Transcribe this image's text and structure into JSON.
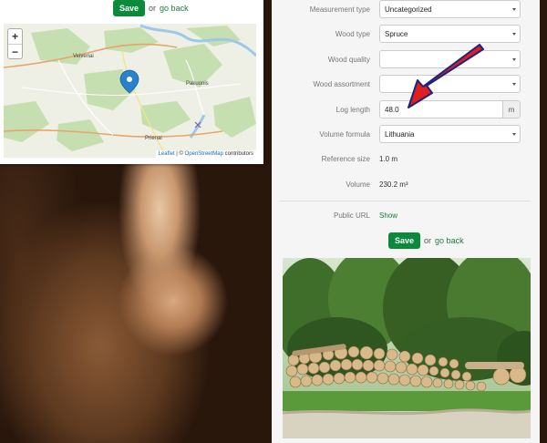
{
  "top_bar": {
    "save_label": "Save",
    "or_text": "or",
    "go_back_label": "go back"
  },
  "map": {
    "zoom_in": "+",
    "zoom_out": "−",
    "places": {
      "veiveriai": "Veiveriai",
      "pakuonis": "Pakuonis",
      "prienai": "Prienai"
    },
    "attribution": {
      "leaflet": "Leaflet",
      "separator": "| ©",
      "osm": "OpenStreetMap",
      "contributors": "contributors"
    }
  },
  "form": {
    "measurement_type": {
      "label": "Measurement type",
      "value": "Uncategorized"
    },
    "wood_type": {
      "label": "Wood type",
      "value": "Spruce"
    },
    "wood_quality": {
      "label": "Wood quality",
      "value": ""
    },
    "wood_assortment": {
      "label": "Wood assortment",
      "value": ""
    },
    "log_length": {
      "label": "Log length",
      "value": "48.0",
      "unit": "m"
    },
    "volume_formula": {
      "label": "Volume formula",
      "value": "Lithuania"
    },
    "reference_size": {
      "label": "Reference size",
      "value": "1.0 m"
    },
    "volume": {
      "label": "Volume",
      "value": "230.2 m³"
    },
    "public_url": {
      "label": "Public URL",
      "link": "Show"
    }
  },
  "bottom_bar": {
    "save_label": "Save",
    "or_text": "or",
    "go_back_label": "go back"
  },
  "colors": {
    "save_green": "#0a8a3a",
    "link_green": "#1b7f3b",
    "annotation_red": "#e01e1e",
    "annotation_outline": "#1a237e"
  }
}
